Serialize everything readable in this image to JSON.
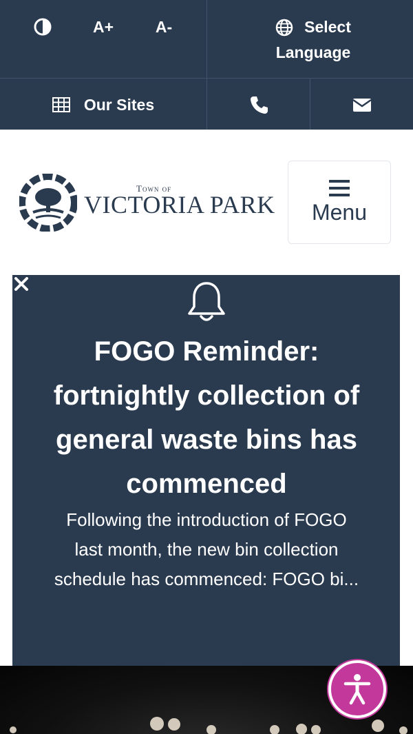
{
  "topbar": {
    "contrast_icon": "contrast-icon",
    "font_increase": "A+",
    "font_decrease": "A-",
    "language_icon": "globe-icon",
    "language_label_line1": "Select",
    "language_label_line2": "Language",
    "sites_icon": "grid-icon",
    "sites_label": "Our Sites",
    "phone_icon": "phone-icon",
    "email_icon": "envelope-icon"
  },
  "header": {
    "logo_small": "Town of",
    "logo_main": "Victoria Park",
    "menu_icon": "hamburger-icon",
    "menu_label": "Menu"
  },
  "alert": {
    "icon": "bell-icon",
    "close_icon": "close-icon",
    "title_lines": [
      "FOGO Reminder:",
      "fortnightly collection of",
      "general waste bins has",
      "commenced"
    ],
    "body_lines": [
      "Following the introduction of FOGO",
      "last month, the new bin collection",
      "schedule has commenced: FOGO bi..."
    ]
  },
  "accessibility": {
    "icon": "accessibility-icon"
  },
  "colors": {
    "navy": "#2a3a4f",
    "accent_pink": "#c2389b",
    "white": "#ffffff"
  }
}
